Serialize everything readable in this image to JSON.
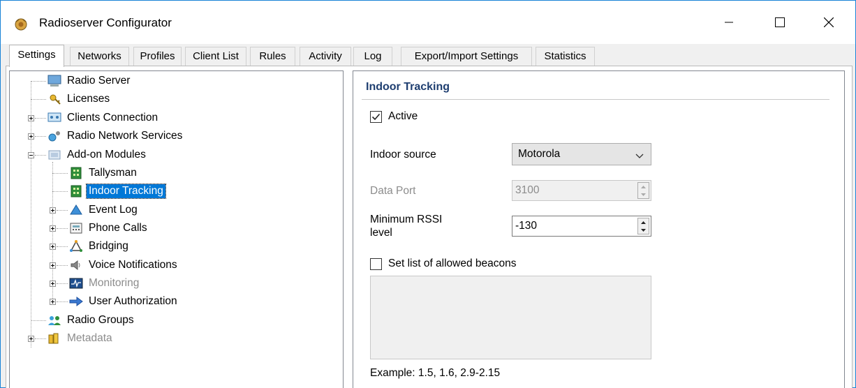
{
  "window": {
    "title": "Radioserver Configurator",
    "app_icon": "radioserver-app-icon",
    "controls": [
      "minimize-icon",
      "maximize-icon",
      "close-icon"
    ]
  },
  "tabs": [
    {
      "label": "Settings",
      "active": true
    },
    {
      "label": "Networks",
      "active": false
    },
    {
      "label": "Profiles",
      "active": false
    },
    {
      "label": "Client List",
      "active": false
    },
    {
      "label": "Rules",
      "active": false
    },
    {
      "label": "Activity",
      "active": false
    },
    {
      "label": "Log",
      "active": false
    },
    {
      "label": "Export/Import Settings",
      "active": false
    },
    {
      "label": "Statistics",
      "active": false
    }
  ],
  "tree": {
    "items": [
      {
        "label": "Radio Server",
        "icon": "server-icon"
      },
      {
        "label": "Licenses",
        "icon": "keys-icon"
      },
      {
        "label": "Clients Connection",
        "icon": "network-icon"
      },
      {
        "label": "Radio Network Services",
        "icon": "services-icon"
      },
      {
        "label": "Add-on Modules",
        "icon": "modules-icon"
      },
      {
        "label": "Tallysman",
        "icon": "module-chip-icon"
      },
      {
        "label": "Indoor Tracking",
        "icon": "module-chip-icon",
        "selected": true
      },
      {
        "label": "Event Log",
        "icon": "event-log-icon"
      },
      {
        "label": "Phone Calls",
        "icon": "phone-calls-icon"
      },
      {
        "label": "Bridging",
        "icon": "bridging-icon"
      },
      {
        "label": "Voice Notifications",
        "icon": "speaker-icon"
      },
      {
        "label": "Monitoring",
        "icon": "monitoring-icon",
        "disabled": true
      },
      {
        "label": "User Authorization",
        "icon": "authorization-icon"
      },
      {
        "label": "Radio Groups",
        "icon": "groups-icon"
      },
      {
        "label": "Metadata",
        "icon": "metadata-icon",
        "disabled": true
      }
    ]
  },
  "panel": {
    "title": "Indoor Tracking",
    "active_label": "Active",
    "active_checked": true,
    "indoor_source_label": "Indoor source",
    "indoor_source_value": "Motorola",
    "data_port_label": "Data Port",
    "data_port_value": "3100",
    "min_rssi_label_line1": "Minimum RSSI",
    "min_rssi_label_line2": "level",
    "min_rssi_value": "-130",
    "beacons_label": "Set list of allowed beacons",
    "beacons_checked": false,
    "example_text": "Example: 1.5, 1.6, 2.9-2.15"
  },
  "colors": {
    "accent": "#0078d7",
    "section_title": "#1e3e70",
    "window_border": "#1883d7"
  }
}
